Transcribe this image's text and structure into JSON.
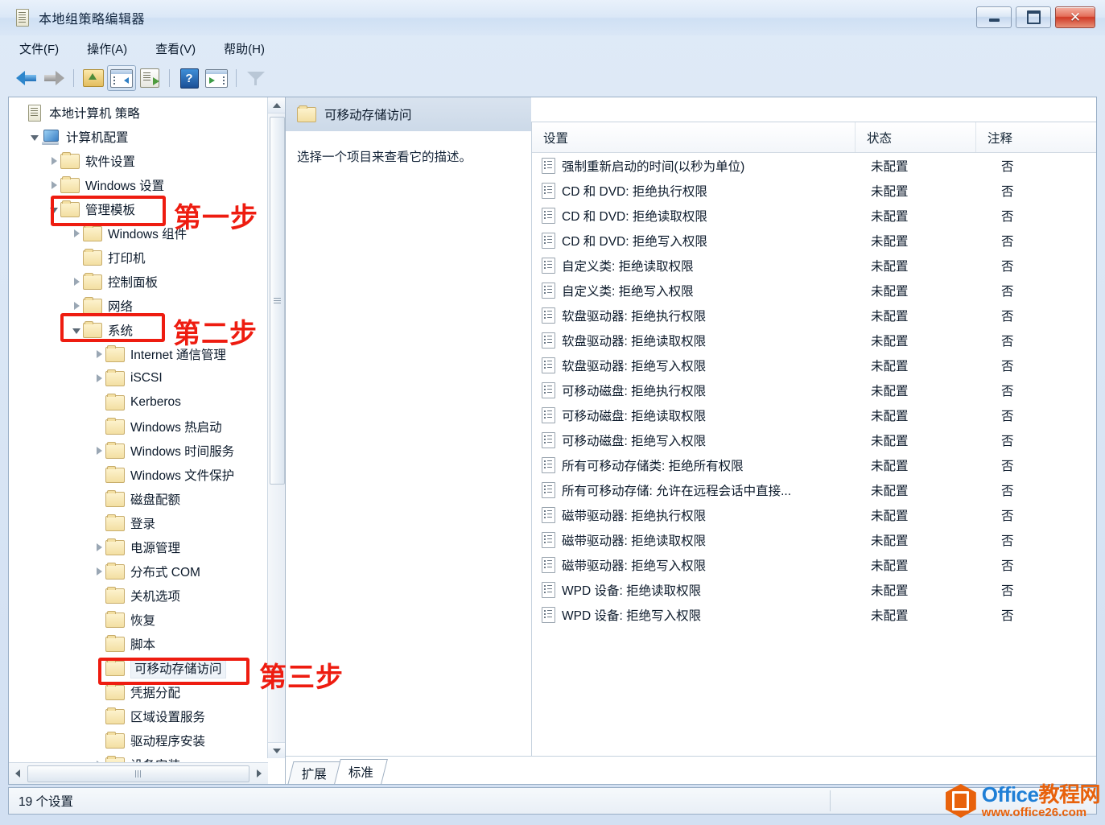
{
  "window": {
    "title": "本地组策略编辑器",
    "icon": "policy-document-icon",
    "buttons": {
      "minimize": "–",
      "maximize": "❐",
      "close": "✕"
    }
  },
  "menubar": {
    "items": [
      {
        "label": "文件(F)",
        "name": "menu-file"
      },
      {
        "label": "操作(A)",
        "name": "menu-action"
      },
      {
        "label": "查看(V)",
        "name": "menu-view"
      },
      {
        "label": "帮助(H)",
        "name": "menu-help"
      }
    ]
  },
  "toolbar": {
    "items": [
      {
        "name": "back-icon",
        "title": "后退"
      },
      {
        "name": "forward-icon",
        "title": "前进"
      },
      {
        "name": "up-one-level-icon",
        "title": "上一级"
      },
      {
        "name": "show-hide-tree-icon",
        "title": "显示/隐藏控制台树"
      },
      {
        "name": "export-list-icon",
        "title": "导出列表"
      },
      {
        "name": "help-icon",
        "title": "帮助"
      },
      {
        "name": "show-action-pane-icon",
        "title": "显示操作窗格"
      },
      {
        "name": "filter-icon",
        "title": "筛选器"
      }
    ]
  },
  "tree": {
    "items": [
      {
        "label": "本地计算机 策略",
        "indent": 0,
        "icon": "policy-document-icon",
        "expander": "none"
      },
      {
        "label": "计算机配置",
        "indent": 1,
        "icon": "computer-icon",
        "expander": "open"
      },
      {
        "label": "软件设置",
        "indent": 2,
        "icon": "folder-icon",
        "expander": "closed"
      },
      {
        "label": "Windows 设置",
        "indent": 2,
        "icon": "folder-icon",
        "expander": "closed"
      },
      {
        "label": "管理模板",
        "indent": 2,
        "icon": "folder-icon",
        "expander": "open"
      },
      {
        "label": "Windows 组件",
        "indent": 3,
        "icon": "folder-icon",
        "expander": "closed"
      },
      {
        "label": "打印机",
        "indent": 3,
        "icon": "folder-icon",
        "expander": "none"
      },
      {
        "label": "控制面板",
        "indent": 3,
        "icon": "folder-icon",
        "expander": "closed"
      },
      {
        "label": "网络",
        "indent": 3,
        "icon": "folder-icon",
        "expander": "closed"
      },
      {
        "label": "系统",
        "indent": 3,
        "icon": "folder-icon",
        "expander": "open"
      },
      {
        "label": "Internet 通信管理",
        "indent": 4,
        "icon": "folder-icon",
        "expander": "closed"
      },
      {
        "label": "iSCSI",
        "indent": 4,
        "icon": "folder-icon",
        "expander": "closed"
      },
      {
        "label": "Kerberos",
        "indent": 4,
        "icon": "folder-icon",
        "expander": "none"
      },
      {
        "label": "Windows 热启动",
        "indent": 4,
        "icon": "folder-icon",
        "expander": "none"
      },
      {
        "label": "Windows 时间服务",
        "indent": 4,
        "icon": "folder-icon",
        "expander": "closed"
      },
      {
        "label": "Windows 文件保护",
        "indent": 4,
        "icon": "folder-icon",
        "expander": "none"
      },
      {
        "label": "磁盘配额",
        "indent": 4,
        "icon": "folder-icon",
        "expander": "none"
      },
      {
        "label": "登录",
        "indent": 4,
        "icon": "folder-icon",
        "expander": "none"
      },
      {
        "label": "电源管理",
        "indent": 4,
        "icon": "folder-icon",
        "expander": "closed"
      },
      {
        "label": "分布式 COM",
        "indent": 4,
        "icon": "folder-icon",
        "expander": "closed"
      },
      {
        "label": "关机选项",
        "indent": 4,
        "icon": "folder-icon",
        "expander": "none"
      },
      {
        "label": "恢复",
        "indent": 4,
        "icon": "folder-icon",
        "expander": "none"
      },
      {
        "label": "脚本",
        "indent": 4,
        "icon": "folder-icon",
        "expander": "none"
      },
      {
        "label": "可移动存储访问",
        "indent": 4,
        "icon": "folder-icon",
        "expander": "none",
        "selected": true
      },
      {
        "label": "凭据分配",
        "indent": 4,
        "icon": "folder-icon",
        "expander": "none"
      },
      {
        "label": "区域设置服务",
        "indent": 4,
        "icon": "folder-icon",
        "expander": "none"
      },
      {
        "label": "驱动程序安装",
        "indent": 4,
        "icon": "folder-icon",
        "expander": "none"
      },
      {
        "label": "设备安装",
        "indent": 4,
        "icon": "folder-icon",
        "expander": "closed"
      }
    ]
  },
  "description": {
    "header": "可移动存储访问",
    "body": "选择一个项目来查看它的描述。"
  },
  "list": {
    "columns": [
      "设置",
      "状态",
      "注释"
    ],
    "rows": [
      {
        "setting": "强制重新启动的时间(以秒为单位)",
        "state": "未配置",
        "comment": "否"
      },
      {
        "setting": "CD 和 DVD: 拒绝执行权限",
        "state": "未配置",
        "comment": "否"
      },
      {
        "setting": "CD 和 DVD: 拒绝读取权限",
        "state": "未配置",
        "comment": "否"
      },
      {
        "setting": "CD 和 DVD: 拒绝写入权限",
        "state": "未配置",
        "comment": "否"
      },
      {
        "setting": "自定义类: 拒绝读取权限",
        "state": "未配置",
        "comment": "否"
      },
      {
        "setting": "自定义类: 拒绝写入权限",
        "state": "未配置",
        "comment": "否"
      },
      {
        "setting": "软盘驱动器: 拒绝执行权限",
        "state": "未配置",
        "comment": "否"
      },
      {
        "setting": "软盘驱动器: 拒绝读取权限",
        "state": "未配置",
        "comment": "否"
      },
      {
        "setting": "软盘驱动器: 拒绝写入权限",
        "state": "未配置",
        "comment": "否"
      },
      {
        "setting": "可移动磁盘: 拒绝执行权限",
        "state": "未配置",
        "comment": "否"
      },
      {
        "setting": "可移动磁盘: 拒绝读取权限",
        "state": "未配置",
        "comment": "否"
      },
      {
        "setting": "可移动磁盘: 拒绝写入权限",
        "state": "未配置",
        "comment": "否"
      },
      {
        "setting": "所有可移动存储类: 拒绝所有权限",
        "state": "未配置",
        "comment": "否"
      },
      {
        "setting": "所有可移动存储: 允许在远程会话中直接...",
        "state": "未配置",
        "comment": "否"
      },
      {
        "setting": "磁带驱动器: 拒绝执行权限",
        "state": "未配置",
        "comment": "否"
      },
      {
        "setting": "磁带驱动器: 拒绝读取权限",
        "state": "未配置",
        "comment": "否"
      },
      {
        "setting": "磁带驱动器: 拒绝写入权限",
        "state": "未配置",
        "comment": "否"
      },
      {
        "setting": "WPD 设备: 拒绝读取权限",
        "state": "未配置",
        "comment": "否"
      },
      {
        "setting": "WPD 设备: 拒绝写入权限",
        "state": "未配置",
        "comment": "否"
      }
    ]
  },
  "tabs": [
    {
      "label": "扩展",
      "active": false
    },
    {
      "label": "标准",
      "active": true
    }
  ],
  "statusbar": {
    "text": "19 个设置"
  },
  "annotations": {
    "color": "#ee1c10",
    "steps": [
      {
        "text": "第一步",
        "target": "管理模板"
      },
      {
        "text": "第二步",
        "target": "系统"
      },
      {
        "text": "第三步",
        "target": "可移动存储访问"
      }
    ]
  },
  "watermark": {
    "line1_a": "Office",
    "line1_b": "教程网",
    "line2": "www.office26.com"
  }
}
